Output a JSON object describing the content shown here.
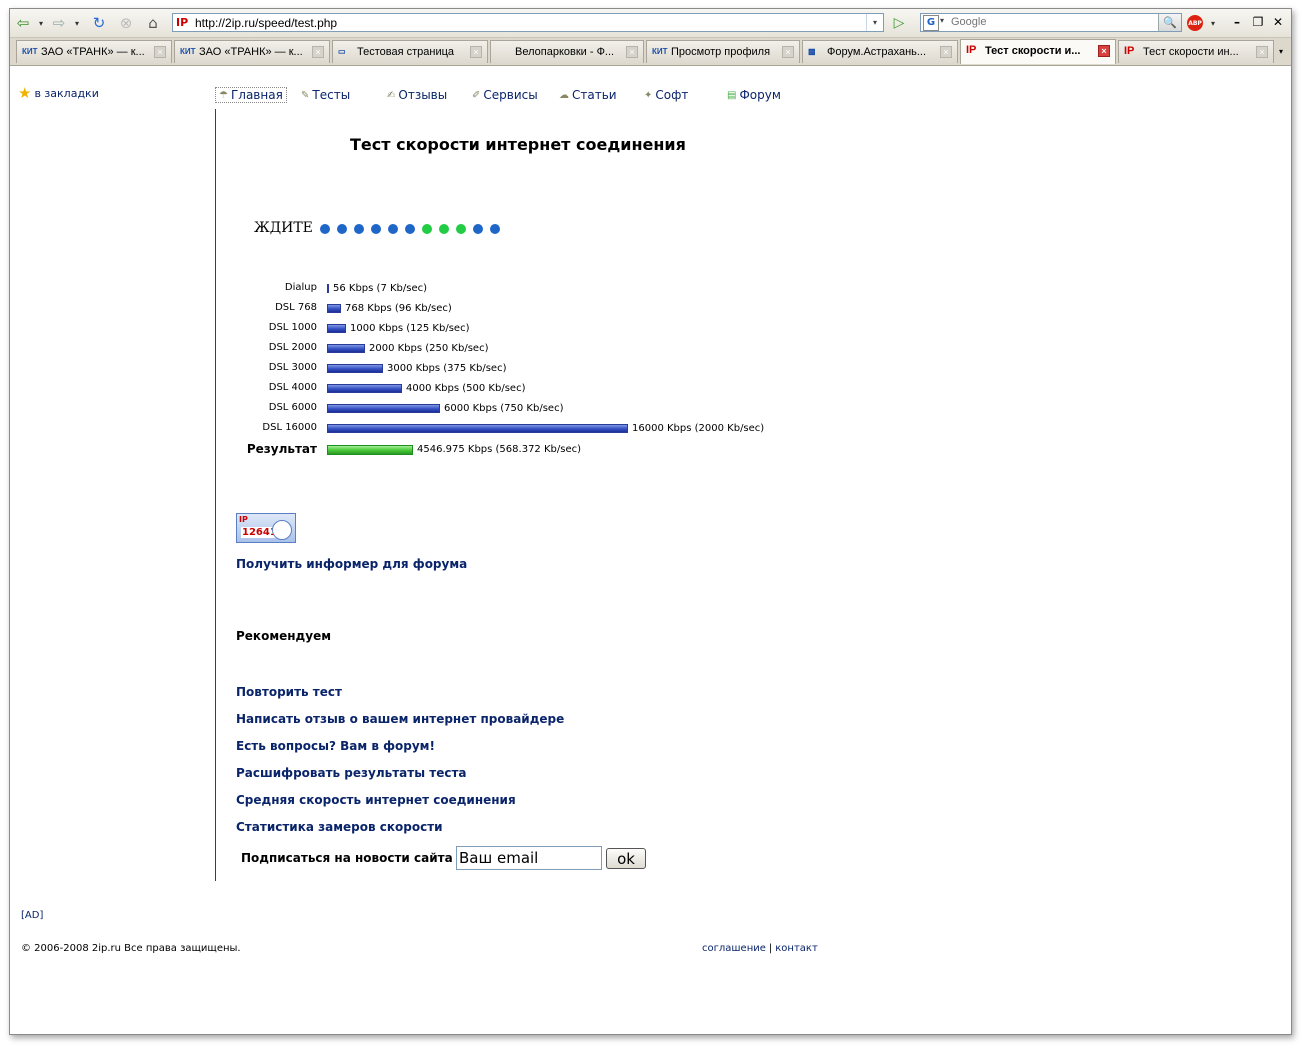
{
  "browser": {
    "url": "http://2ip.ru/speed/test.php",
    "search_placeholder": "Google",
    "abp_label": "ABP"
  },
  "tabs": [
    {
      "icon": "КИТ",
      "title": "ЗАО «ТРАНК» — к...",
      "active": false
    },
    {
      "icon": "КИТ",
      "title": "ЗАО «ТРАНК» — к...",
      "active": false
    },
    {
      "icon": "▭",
      "title": "Тестовая страница",
      "active": false
    },
    {
      "icon": "",
      "title": "Велопарковки - Ф...",
      "active": false
    },
    {
      "icon": "КИТ",
      "title": "Просмотр профиля",
      "active": false
    },
    {
      "icon": "▩",
      "title": "Форум.Астрахань...",
      "active": false
    },
    {
      "icon": "IP",
      "title": "Тест скорости и...",
      "active": true
    },
    {
      "icon": "IP",
      "title": "Тест скорости ин...",
      "active": false
    }
  ],
  "sidebar": {
    "bookmark_label": "в закладки"
  },
  "nav": {
    "items": [
      "Главная",
      "Тесты",
      "Отзывы",
      "Сервисы",
      "Статьи",
      "Софт",
      "Форум"
    ]
  },
  "page": {
    "title": "Тест скорости интернет соединения",
    "wait_label": "ЖДИТЕ",
    "dots": [
      "#1f66c9",
      "#1f66c9",
      "#1f66c9",
      "#1f66c9",
      "#1f66c9",
      "#1f66c9",
      "#22cc44",
      "#22cc44",
      "#22cc44",
      "#1f66c9",
      "#1f66c9"
    ]
  },
  "chart_data": {
    "type": "bar",
    "categories": [
      "Dialup",
      "DSL 768",
      "DSL 1000",
      "DSL 2000",
      "DSL 3000",
      "DSL 4000",
      "DSL 6000",
      "DSL 16000",
      "Результат"
    ],
    "values": [
      56,
      768,
      1000,
      2000,
      3000,
      4000,
      6000,
      16000,
      4546.975
    ],
    "value_labels": [
      "56 Kbps (7 Kb/sec)",
      "768 Kbps (96 Kb/sec)",
      "1000 Kbps (125 Kb/sec)",
      "2000 Kbps (250 Kb/sec)",
      "3000 Kbps (375 Kb/sec)",
      "4000 Kbps (500 Kb/sec)",
      "6000 Kbps (750 Kb/sec)",
      "16000 Kbps (2000 Kb/sec)",
      "4546.975 Kbps (568.372 Kb/sec)"
    ],
    "unit": "Kbps",
    "orientation": "horizontal",
    "colors": {
      "reference": "#3a55c8",
      "result": "#4ccb3c"
    }
  },
  "informer": {
    "logo": "IP",
    "number": "12641"
  },
  "links": {
    "informer": "Получить информер для форума",
    "recommend": "Рекомендуем",
    "repeat": "Повторить тест",
    "review": "Написать отзыв о вашем интернет провайдере",
    "forum": "Есть вопросы? Вам в форум!",
    "decode": "Расшифровать результаты теста",
    "average": "Средняя скорость интернет соединения",
    "stats": "Статистика замеров скорости"
  },
  "subscribe": {
    "label": "Подписаться на новости сайта",
    "email_value": "Ваш email",
    "button": "ok"
  },
  "footer": {
    "ad": "[AD]",
    "copyright": "© 2006-2008 2ip.ru Все права защищены.",
    "agreement": "соглашение",
    "separator": "|",
    "contact": "контакт"
  }
}
